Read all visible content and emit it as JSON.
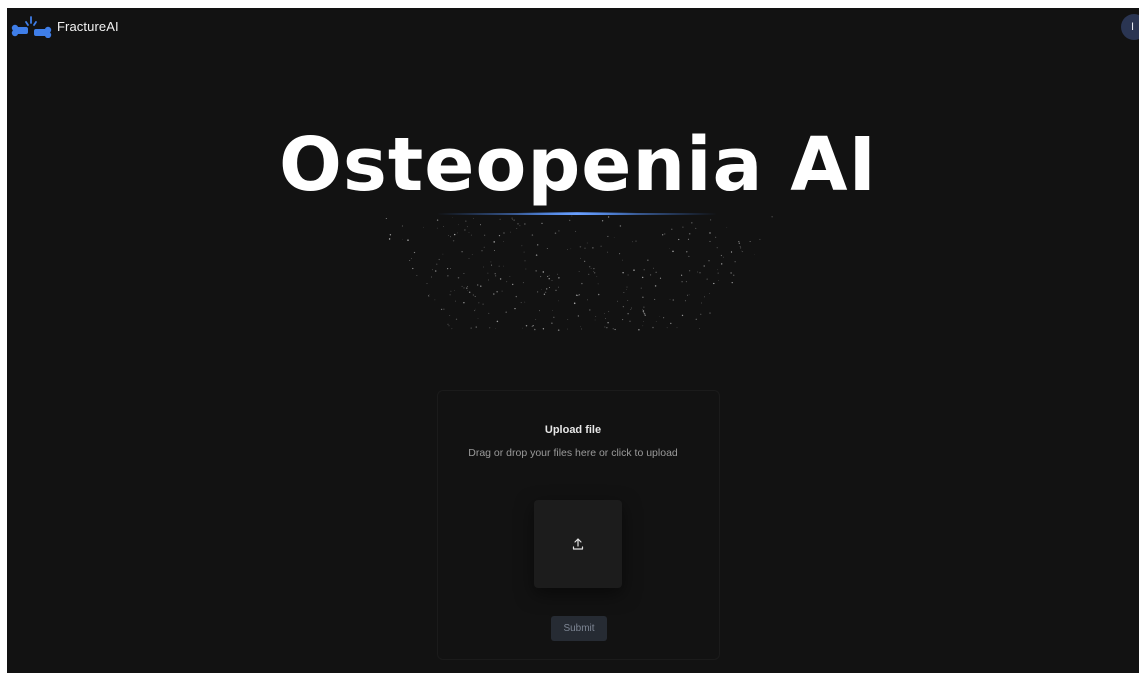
{
  "header": {
    "brand": "FractureAI",
    "avatar_initial": "I"
  },
  "hero": {
    "title": "Osteopenia AI"
  },
  "upload": {
    "title": "Upload file",
    "subtitle": "Drag or drop your files here or click to upload",
    "submit_label": "Submit"
  },
  "colors": {
    "background": "#121212",
    "accent": "#3f7ee8",
    "avatar": "#2a3552",
    "button": "#262b33"
  },
  "icons": {
    "logo": "bone-fracture-logo",
    "upload": "upload-icon"
  }
}
